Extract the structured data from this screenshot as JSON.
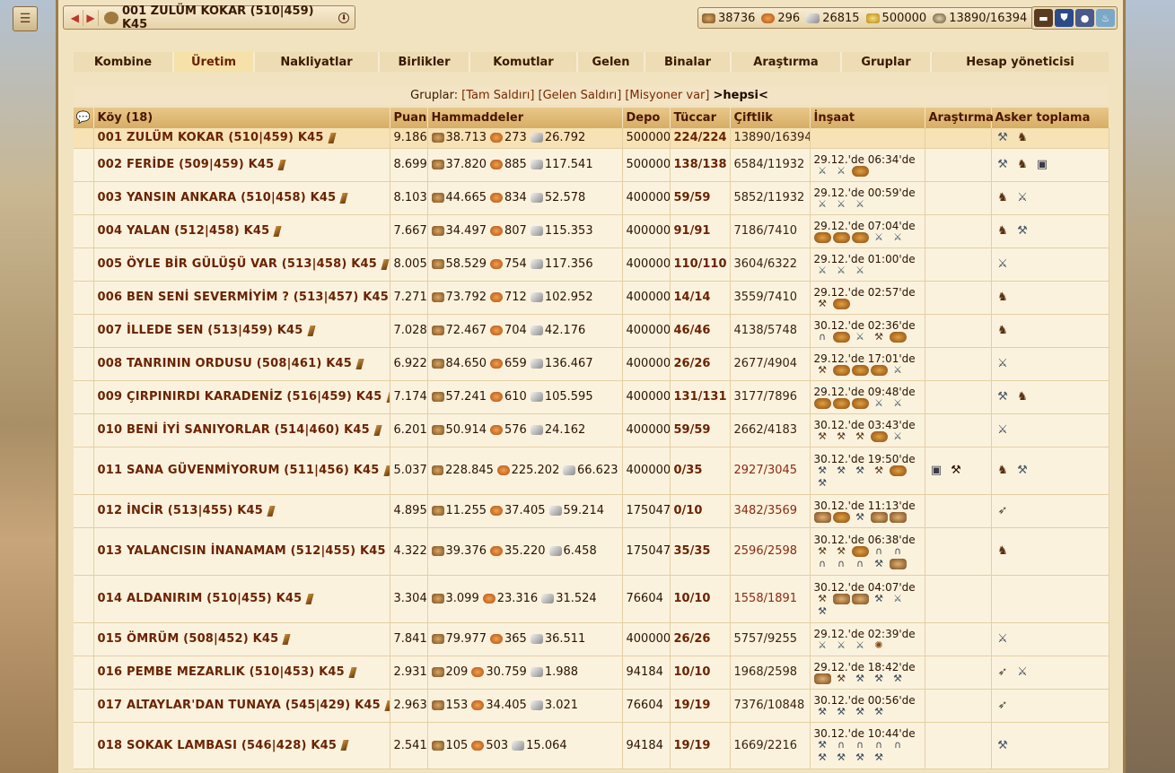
{
  "top": {
    "village_name": "001 ZULÜM KOKAR  (510|459) K45",
    "resources": [
      {
        "icon": "wood-icon",
        "value": "38736"
      },
      {
        "icon": "food-icon",
        "value": "296"
      },
      {
        "icon": "stone-icon",
        "value": "26815"
      },
      {
        "icon": "gold-icon",
        "value": "500000"
      },
      {
        "icon": "population-icon",
        "value": "13890/16394"
      }
    ]
  },
  "tabs": [
    "Kombine",
    "Üretim",
    "Nakliyatlar",
    "Birlikler",
    "Komutlar",
    "Gelen",
    "Binalar",
    "Araştırma",
    "Gruplar",
    "Hesap yöneticisi"
  ],
  "active_tab": "Üretim",
  "groups": {
    "label": "Gruplar:",
    "items": [
      "[Tam Saldırı]",
      "[Gelen Saldırı]",
      "[Misyoner var]"
    ],
    "current": ">hepsi<"
  },
  "table": {
    "headers": [
      "Köy (18)",
      "Puan",
      "Hammaddeler",
      "Depo",
      "Tüccar",
      "Çiftlik",
      "İnşaat",
      "Araştırma",
      "Asker toplama"
    ],
    "rows": [
      {
        "name": "001 ZULÜM KOKAR (510|459) K45",
        "puan": "9.186",
        "wood": "38.713",
        "food": "273",
        "stone": "26.792",
        "depo": "500000",
        "tuccar": "224/224",
        "ciftlik": "13890/16394",
        "insaat_time": "",
        "insaat_icons": [],
        "arastirma": [],
        "asker": [
          "axe",
          "horse"
        ]
      },
      {
        "name": "002 FERİDE (509|459) K45",
        "puan": "8.699",
        "wood": "37.820",
        "food": "885",
        "stone": "117.541",
        "depo": "500000",
        "tuccar": "138/138",
        "ciftlik": "6584/11932",
        "insaat_time": "29.12.'de 06:34'de",
        "insaat_icons": [
          "sword",
          "sword",
          "bread"
        ],
        "arastirma": [],
        "asker": [
          "axe",
          "horse",
          "shield"
        ]
      },
      {
        "name": "003 YANSIN ANKARA (510|458) K45",
        "puan": "8.103",
        "wood": "44.665",
        "food": "834",
        "stone": "52.578",
        "depo": "400000",
        "tuccar": "59/59",
        "ciftlik": "5852/11932",
        "insaat_time": "29.12.'de 00:59'de",
        "insaat_icons": [
          "sword",
          "sword",
          "sword"
        ],
        "arastirma": [],
        "asker": [
          "horse",
          "sword"
        ]
      },
      {
        "name": "004 YALAN (512|458) K45",
        "puan": "7.667",
        "wood": "34.497",
        "food": "807",
        "stone": "115.353",
        "depo": "400000",
        "tuccar": "91/91",
        "ciftlik": "7186/7410",
        "insaat_time": "29.12.'de 07:04'de",
        "insaat_icons": [
          "bread",
          "bread",
          "bread",
          "sword",
          "sword"
        ],
        "arastirma": [],
        "asker": [
          "horse",
          "axe"
        ]
      },
      {
        "name": "005 ÖYLE BİR GÜLÜŞÜ VAR (513|458) K45",
        "puan": "8.005",
        "wood": "58.529",
        "food": "754",
        "stone": "117.356",
        "depo": "400000",
        "tuccar": "110/110",
        "ciftlik": "3604/6322",
        "insaat_time": "29.12.'de 01:00'de",
        "insaat_icons": [
          "sword",
          "sword",
          "sword"
        ],
        "arastirma": [],
        "asker": [
          "sword"
        ]
      },
      {
        "name": "006 BEN SENİ SEVERMİYİM ? (513|457) K45",
        "puan": "7.271",
        "wood": "73.792",
        "food": "712",
        "stone": "102.952",
        "depo": "400000",
        "tuccar": "14/14",
        "ciftlik": "3559/7410",
        "insaat_time": "29.12.'de 02:57'de",
        "insaat_icons": [
          "cart",
          "bread"
        ],
        "arastirma": [],
        "asker": [
          "horse"
        ]
      },
      {
        "name": "007 İLLEDE SEN (513|459) K45",
        "puan": "7.028",
        "wood": "72.467",
        "food": "704",
        "stone": "42.176",
        "depo": "400000",
        "tuccar": "46/46",
        "ciftlik": "4138/5748",
        "insaat_time": "30.12.'de 02:36'de",
        "insaat_icons": [
          "shoe",
          "bread",
          "sword",
          "cart",
          "bread"
        ],
        "arastirma": [],
        "asker": [
          "horse"
        ]
      },
      {
        "name": "008 TANRININ ORDUSU (508|461) K45",
        "puan": "6.922",
        "wood": "84.650",
        "food": "659",
        "stone": "136.467",
        "depo": "400000",
        "tuccar": "26/26",
        "ciftlik": "2677/4904",
        "insaat_time": "29.12.'de 17:01'de",
        "insaat_icons": [
          "cart",
          "bread",
          "bread",
          "bread",
          "sword"
        ],
        "arastirma": [],
        "asker": [
          "sword"
        ]
      },
      {
        "name": "009 ÇIRPINIRDI KARADENİZ (516|459) K45",
        "puan": "7.174",
        "wood": "57.241",
        "food": "610",
        "stone": "105.595",
        "depo": "400000",
        "tuccar": "131/131",
        "ciftlik": "3177/7896",
        "insaat_time": "29.12.'de 09:48'de",
        "insaat_icons": [
          "bread",
          "bread",
          "bread",
          "sword",
          "sword"
        ],
        "arastirma": [],
        "asker": [
          "axe",
          "horse"
        ]
      },
      {
        "name": "010 BENİ İYİ SANIYORLAR (514|460) K45",
        "puan": "6.201",
        "wood": "50.914",
        "food": "576",
        "stone": "24.162",
        "depo": "400000",
        "tuccar": "59/59",
        "ciftlik": "2662/4183",
        "insaat_time": "30.12.'de 03:43'de",
        "insaat_icons": [
          "cart",
          "cart",
          "cart",
          "bread",
          "sword"
        ],
        "arastirma": [],
        "asker": [
          "sword"
        ]
      },
      {
        "name": "011 SANA GÜVENMİYORUM (511|456) K45",
        "puan": "5.037",
        "wood": "228.845",
        "food": "225.202",
        "stone": "66.623",
        "depo": "400000",
        "tuccar": "0/35",
        "ciftlik": "2927/3045",
        "insaat_time": "30.12.'de 19:50'de",
        "insaat_icons": [
          "anvil",
          "anvil",
          "anvil",
          "cart",
          "bread",
          "anvil"
        ],
        "arastirma": [
          "shield",
          "cart"
        ],
        "asker": [
          "horse",
          "axe"
        ]
      },
      {
        "name": "012 İNCİR (513|455) K45",
        "puan": "4.895",
        "wood": "11.255",
        "food": "37.405",
        "stone": "59.214",
        "depo": "175047",
        "tuccar": "0/10",
        "ciftlik": "3482/3569",
        "insaat_time": "30.12.'de 11:13'de",
        "insaat_icons": [
          "res",
          "bread",
          "anvil",
          "res",
          "res"
        ],
        "arastirma": [],
        "asker": [
          "spear"
        ]
      },
      {
        "name": "013 YALANCISIN İNANAMAM (512|455) K45",
        "puan": "4.322",
        "wood": "39.376",
        "food": "35.220",
        "stone": "6.458",
        "depo": "175047",
        "tuccar": "35/35",
        "ciftlik": "2596/2598",
        "insaat_time": "30.12.'de 06:38'de",
        "insaat_icons": [
          "cart",
          "cart",
          "bread",
          "shoe",
          "shoe",
          "shoe",
          "shoe",
          "shoe",
          "anvil",
          "res"
        ],
        "arastirma": [],
        "asker": [
          "horse"
        ]
      },
      {
        "name": "014 ALDANIRIM (510|455) K45",
        "puan": "3.304",
        "wood": "3.099",
        "food": "23.316",
        "stone": "31.524",
        "depo": "76604",
        "tuccar": "10/10",
        "ciftlik": "1558/1891",
        "insaat_time": "30.12.'de 04:07'de",
        "insaat_icons": [
          "cart",
          "res",
          "res",
          "anvil",
          "sword",
          "anvil"
        ],
        "arastirma": [],
        "asker": []
      },
      {
        "name": "015 ÖMRÜM (508|452) K45",
        "puan": "7.841",
        "wood": "79.977",
        "food": "365",
        "stone": "36.511",
        "depo": "400000",
        "tuccar": "26/26",
        "ciftlik": "5757/9255",
        "insaat_time": "29.12.'de 02:39'de",
        "insaat_icons": [
          "sword",
          "sword",
          "sword",
          "wheel"
        ],
        "arastirma": [],
        "asker": [
          "sword"
        ]
      },
      {
        "name": "016 PEMBE MEZARLIK (510|453) K45",
        "puan": "2.931",
        "wood": "209",
        "food": "30.759",
        "stone": "1.988",
        "depo": "94184",
        "tuccar": "10/10",
        "ciftlik": "1968/2598",
        "insaat_time": "29.12.'de 18:42'de",
        "insaat_icons": [
          "res",
          "cart",
          "anvil",
          "anvil",
          "anvil"
        ],
        "arastirma": [],
        "asker": [
          "spear",
          "sword"
        ]
      },
      {
        "name": "017 ALTAYLAR'DAN TUNAYA (545|429) K45",
        "puan": "2.963",
        "wood": "153",
        "food": "34.405",
        "stone": "3.021",
        "depo": "76604",
        "tuccar": "19/19",
        "ciftlik": "7376/10848",
        "insaat_time": "30.12.'de 00:56'de",
        "insaat_icons": [
          "anvil",
          "anvil",
          "anvil",
          "anvil"
        ],
        "arastirma": [],
        "asker": [
          "spear"
        ]
      },
      {
        "name": "018 SOKAK LAMBASI (546|428) K45",
        "puan": "2.541",
        "wood": "105",
        "food": "503",
        "stone": "15.064",
        "depo": "94184",
        "tuccar": "19/19",
        "ciftlik": "1669/2216",
        "insaat_time": "30.12.'de 10:44'de",
        "insaat_icons": [
          "anvil",
          "shoe",
          "shoe",
          "shoe",
          "shoe",
          "anvil",
          "anvil",
          "anvil",
          "anvil"
        ],
        "arastirma": [],
        "asker": [
          "axe"
        ]
      }
    ]
  }
}
